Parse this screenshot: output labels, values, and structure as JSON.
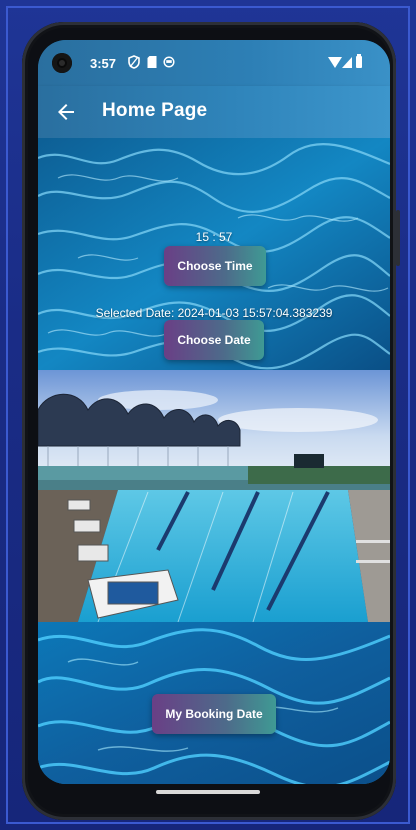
{
  "status_bar": {
    "time": "3:57",
    "icons": [
      "camera-hole",
      "vpn-icon",
      "sd-card-icon",
      "app-notification-icon",
      "wifi-icon",
      "signal-icon",
      "battery-icon"
    ]
  },
  "app_bar": {
    "title": "Home Page",
    "back_icon": "arrow-left-icon"
  },
  "booking": {
    "time_display": "15 : 57",
    "choose_time_label": "Choose Time",
    "selected_date_text": "Selected Date: 2024-01-03 15:57:04.383239",
    "choose_date_label": "Choose Date",
    "my_booking_label": "My Booking Date"
  },
  "colors": {
    "appbar_start": "#2a6f9f",
    "appbar_end": "#3d96cc",
    "button_start": "#6a3f86",
    "button_end": "#3f9a94",
    "water": "#0f6fa8"
  }
}
